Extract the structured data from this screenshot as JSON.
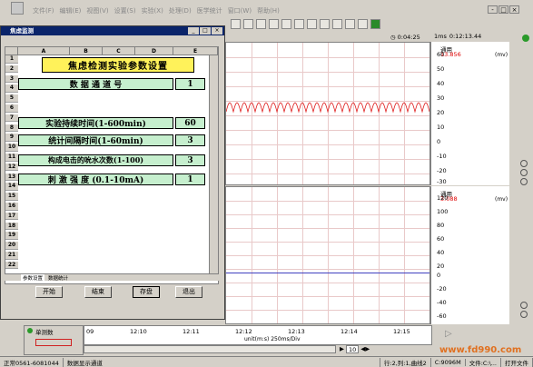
{
  "menu": [
    "文件(F)",
    "编辑(E)",
    "视图(V)",
    "设置(S)",
    "实验(X)",
    "处理(D)",
    "医学统计",
    "窗口(W)",
    "帮助(H)"
  ],
  "window_controls": [
    "-",
    "□",
    "×"
  ],
  "dialog": {
    "title": "焦虑监测",
    "controls": [
      "_",
      "□",
      "×"
    ],
    "columns": [
      "A",
      "B",
      "C",
      "D",
      "E"
    ],
    "rows": [
      "1",
      "2",
      "3",
      "4",
      "5",
      "6",
      "7",
      "8",
      "9",
      "10",
      "11",
      "12",
      "13",
      "14",
      "15",
      "16",
      "17",
      "18",
      "19",
      "20",
      "21",
      "22"
    ],
    "title_cell": "焦虑检测实验参数设置",
    "params": [
      {
        "label": "数  据  通  道  号",
        "value": "1"
      },
      {
        "label": "实验持续时间(1-600min)",
        "value": "60"
      },
      {
        "label": "统计间隔时间(1-60min)",
        "value": "3"
      },
      {
        "label": "构成电击的吮水次数(1-100)",
        "value": "3"
      },
      {
        "label": "刺  激  强  度  (0.1-10mA)",
        "value": "1"
      }
    ],
    "sheet_tabs": [
      "参数设置",
      "数据统计"
    ],
    "buttons": {
      "start": "开始",
      "end": "结束",
      "save": "存盘",
      "exit": "退出"
    }
  },
  "toolbar": {
    "time": "0:04:25",
    "sample_time": "0:12:13.44",
    "unit_prefix": "1ms"
  },
  "channels": [
    {
      "name": "通用",
      "value": "13.856",
      "unit": "(mv)",
      "ticks": [
        "60",
        "50",
        "40",
        "30",
        "20",
        "10",
        "0",
        "-10",
        "-20",
        "-30"
      ]
    },
    {
      "name": "通用",
      "value": "3.088",
      "unit": "(mv)",
      "ticks": [
        "120",
        "100",
        "80",
        "60",
        "40",
        "20",
        "0",
        "-20",
        "-40",
        "-60"
      ]
    }
  ],
  "colors": {
    "ch1_trace": "#e02020",
    "ch2_trace": "#4040c0",
    "grid": "#e9c9c9",
    "dialog_title": "#0a246a",
    "param_cell": "#c6efce",
    "title_cell": "#fff25a"
  },
  "timebar": {
    "mode_label": "单测数",
    "labels": [
      "09",
      "12:10",
      "12:11",
      "12:12",
      "12:13",
      "12:14",
      "12:15"
    ],
    "unit_label": "unit(m:s) 250ms/Div",
    "zoom": "10"
  },
  "statusbar": [
    "正常0561-6081044",
    "数据显示通道",
    "行:2,列:1,曲线2",
    "C:9096M",
    "文件:C:\\...",
    "打开文件"
  ],
  "watermark": "www.fd990.com"
}
